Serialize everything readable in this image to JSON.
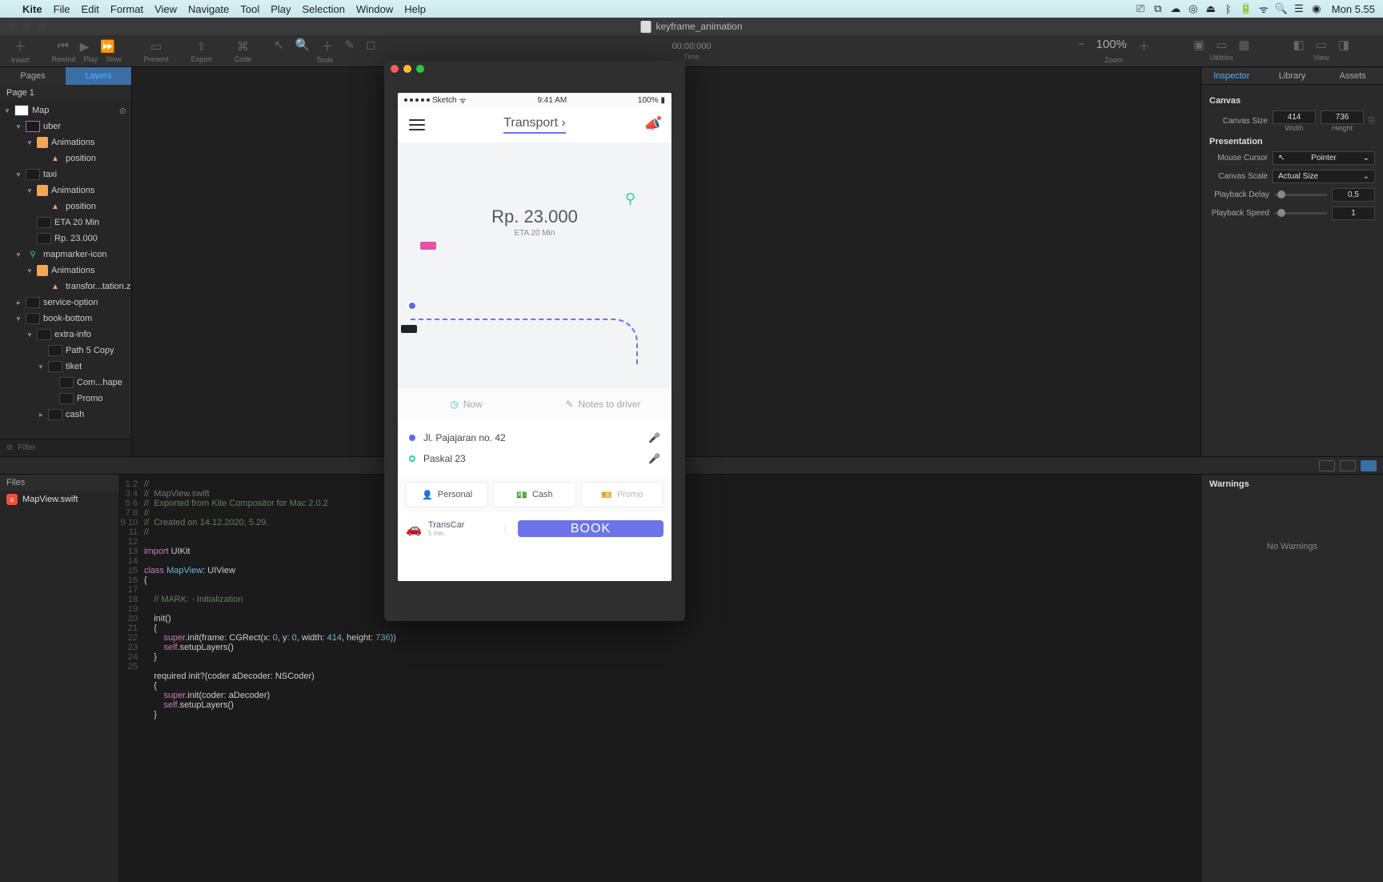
{
  "menubar": {
    "app": "Kite",
    "items": [
      "File",
      "Edit",
      "Format",
      "View",
      "Navigate",
      "Tool",
      "Play",
      "Selection",
      "Window",
      "Help"
    ],
    "clock": "Mon 5.55"
  },
  "window": {
    "title": "keyframe_animation"
  },
  "toolbar": {
    "groups": {
      "insert": "Insert",
      "rewind": "Rewind",
      "play": "Play",
      "slow": "Slow",
      "present": "Present",
      "export": "Export",
      "code": "Code",
      "tools": "Tools",
      "time_value": "00:00:000",
      "time_label": "Time",
      "zoom_value": "100%",
      "zoom_label": "Zoom",
      "utilities": "Utilities",
      "view": "View"
    }
  },
  "left": {
    "tabs": [
      "Pages",
      "Layers"
    ],
    "page_header": "Page 1",
    "tree": [
      {
        "d": 0,
        "exp": "down",
        "ico": "artboard",
        "label": "Map",
        "link": true
      },
      {
        "d": 1,
        "exp": "down",
        "ico": "pink",
        "label": "uber"
      },
      {
        "d": 2,
        "exp": "down",
        "ico": "anim",
        "label": "Animations"
      },
      {
        "d": 3,
        "exp": "",
        "ico": "prop",
        "label": "position"
      },
      {
        "d": 1,
        "exp": "down",
        "ico": "dark",
        "label": "taxi"
      },
      {
        "d": 2,
        "exp": "down",
        "ico": "anim",
        "label": "Animations"
      },
      {
        "d": 3,
        "exp": "",
        "ico": "prop",
        "label": "position"
      },
      {
        "d": 2,
        "exp": "",
        "ico": "sq",
        "label": "ETA 20 Min"
      },
      {
        "d": 2,
        "exp": "",
        "ico": "sq",
        "label": "Rp. 23.000"
      },
      {
        "d": 1,
        "exp": "down",
        "ico": "marker",
        "label": "mapmarker-icon"
      },
      {
        "d": 2,
        "exp": "down",
        "ico": "anim",
        "label": "Animations"
      },
      {
        "d": 3,
        "exp": "",
        "ico": "prop",
        "label": "transfor...tation.z"
      },
      {
        "d": 1,
        "exp": "right",
        "ico": "sq",
        "label": "service-option"
      },
      {
        "d": 1,
        "exp": "down",
        "ico": "sq",
        "label": "book-bottom"
      },
      {
        "d": 2,
        "exp": "down",
        "ico": "sq",
        "label": "extra-info"
      },
      {
        "d": 3,
        "exp": "",
        "ico": "sq",
        "label": "Path 5 Copy"
      },
      {
        "d": 3,
        "exp": "down",
        "ico": "sq",
        "label": "tiket"
      },
      {
        "d": 4,
        "exp": "",
        "ico": "sq",
        "label": "Com...hape"
      },
      {
        "d": 4,
        "exp": "",
        "ico": "sq",
        "label": "Promo"
      },
      {
        "d": 3,
        "exp": "right",
        "ico": "sq",
        "label": "cash"
      }
    ],
    "filter": "Filter"
  },
  "right": {
    "tabs": [
      "Inspector",
      "Library",
      "Assets"
    ],
    "canvas_label": "Canvas",
    "canvas_size_label": "Canvas Size",
    "width": "414",
    "width_label": "Width",
    "height": "736",
    "height_label": "Height",
    "presentation_label": "Presentation",
    "mouse_cursor_label": "Mouse Cursor",
    "mouse_cursor": "Pointer",
    "canvas_scale_label": "Canvas Scale",
    "canvas_scale": "Actual Size",
    "playback_delay_label": "Playback Delay",
    "playback_delay": "0,5",
    "playback_speed_label": "Playback Speed",
    "playback_speed": "1"
  },
  "files": {
    "header": "Files",
    "items": [
      "MapView.swift"
    ]
  },
  "code_comment_lines": [
    "//",
    "//  MapView.swift",
    "//  Exported from Kite Compositor for Mac 2.0.2",
    "//",
    "//  Created on 14.12.2020, 5.29.",
    "//"
  ],
  "code_body": {
    "import": "import",
    "uikit": "UIKit",
    "class": "class",
    "classname": "MapView",
    "colon_ui": ": UIView",
    "mark": "// MARK: - Initialization",
    "init": "init()",
    "super_init_frame": "super",
    "init_frame_rest": ".init(frame: CGRect(x: ",
    "zero": "0",
    "comma_y": ", y: ",
    "width_kw": ", width: ",
    "w414": "414",
    "height_kw": ", height: ",
    "h736": "736",
    "close_paren": "))",
    "setup": "self",
    "setup_rest": ".setupLayers()",
    "required": "required init?(coder aDecoder: NSCoder)",
    "super_init_coder": "super",
    "coder_rest": ".init(coder: aDecoder)"
  },
  "warnings": {
    "header": "Warnings",
    "empty": "No Warnings"
  },
  "preview": {
    "status_carrier": "Sketch",
    "status_time": "9:41 AM",
    "status_batt": "100%",
    "header_title": "Transport",
    "price": "Rp. 23.000",
    "eta": "ETA 20 Min",
    "quick_now": "Now",
    "quick_notes": "Notes to driver",
    "addr_from": "Jl. Pajajaran no. 42",
    "addr_to": "Paskal 23",
    "opt_personal": "Personal",
    "opt_cash": "Cash",
    "opt_promo": "Promo",
    "car_name": "TransCar",
    "car_sub": "5 min",
    "book": "BOOK"
  }
}
